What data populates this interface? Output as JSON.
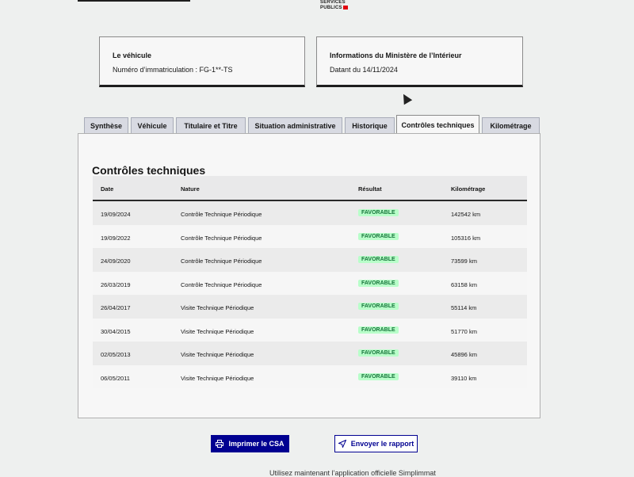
{
  "header": {
    "logo_text_1": "SERVICES",
    "logo_text_2": "PUBLICS"
  },
  "vehicle_card": {
    "title": "Le véhicule",
    "registration": "Numéro d’immatriculation : FG-1**-TS"
  },
  "info_card": {
    "title": "Informations du Ministère de l’Intérieur",
    "date": "Datant du 14/11/2024"
  },
  "tabs": [
    {
      "label": "Synthèse"
    },
    {
      "label": "Véhicule"
    },
    {
      "label": "Titulaire et Titre"
    },
    {
      "label": "Situation administrative"
    },
    {
      "label": "Historique"
    },
    {
      "label": "Contrôles techniques",
      "active": true
    },
    {
      "label": "Kilométrage"
    }
  ],
  "section": {
    "title": "Contrôles techniques",
    "columns": {
      "date": "Date",
      "nature": "Nature",
      "result": "Résultat",
      "mileage": "Kilométrage"
    },
    "rows": [
      {
        "date": "19/09/2024",
        "nature": "Contrôle Technique Périodique",
        "result": "FAVORABLE",
        "mileage": "142542 km"
      },
      {
        "date": "19/09/2022",
        "nature": "Contrôle Technique Périodique",
        "result": "FAVORABLE",
        "mileage": "105316 km"
      },
      {
        "date": "24/09/2020",
        "nature": "Contrôle Technique Périodique",
        "result": "FAVORABLE",
        "mileage": "73599 km"
      },
      {
        "date": "26/03/2019",
        "nature": "Contrôle Technique Périodique",
        "result": "FAVORABLE",
        "mileage": "63158 km"
      },
      {
        "date": "26/04/2017",
        "nature": "Visite Technique Périodique",
        "result": "FAVORABLE",
        "mileage": "55114 km"
      },
      {
        "date": "30/04/2015",
        "nature": "Visite Technique Périodique",
        "result": "FAVORABLE",
        "mileage": "51770 km"
      },
      {
        "date": "02/05/2013",
        "nature": "Visite Technique Périodique",
        "result": "FAVORABLE",
        "mileage": "45896 km"
      },
      {
        "date": "06/05/2011",
        "nature": "Visite Technique Périodique",
        "result": "FAVORABLE",
        "mileage": "39110 km"
      }
    ]
  },
  "actions": {
    "print_label": "Imprimer le CSA",
    "send_label": "Envoyer le rapport"
  },
  "footer": {
    "text": "Utilisez maintenant l’application officielle Simplimmat"
  },
  "colors": {
    "primary": "#000091",
    "badge_bg": "#b8fec9",
    "badge_text": "#18753c"
  }
}
